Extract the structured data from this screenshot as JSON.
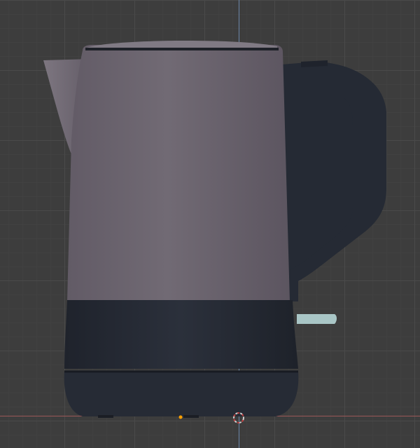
{
  "viewport": {
    "background": "#3d3d3d",
    "grid_minor": "#414141",
    "grid_major": "#4a4a4a",
    "axis_z_color": "#6b86a8",
    "axis_x_color": "#9a5757"
  },
  "model": {
    "body_color": "#6e6670",
    "base_color": "#262b35",
    "handle_color": "#252a34",
    "switch_color": "#a9c6c6",
    "cursor_color": "#d0d0d0",
    "origin_color": "#ffa000"
  }
}
